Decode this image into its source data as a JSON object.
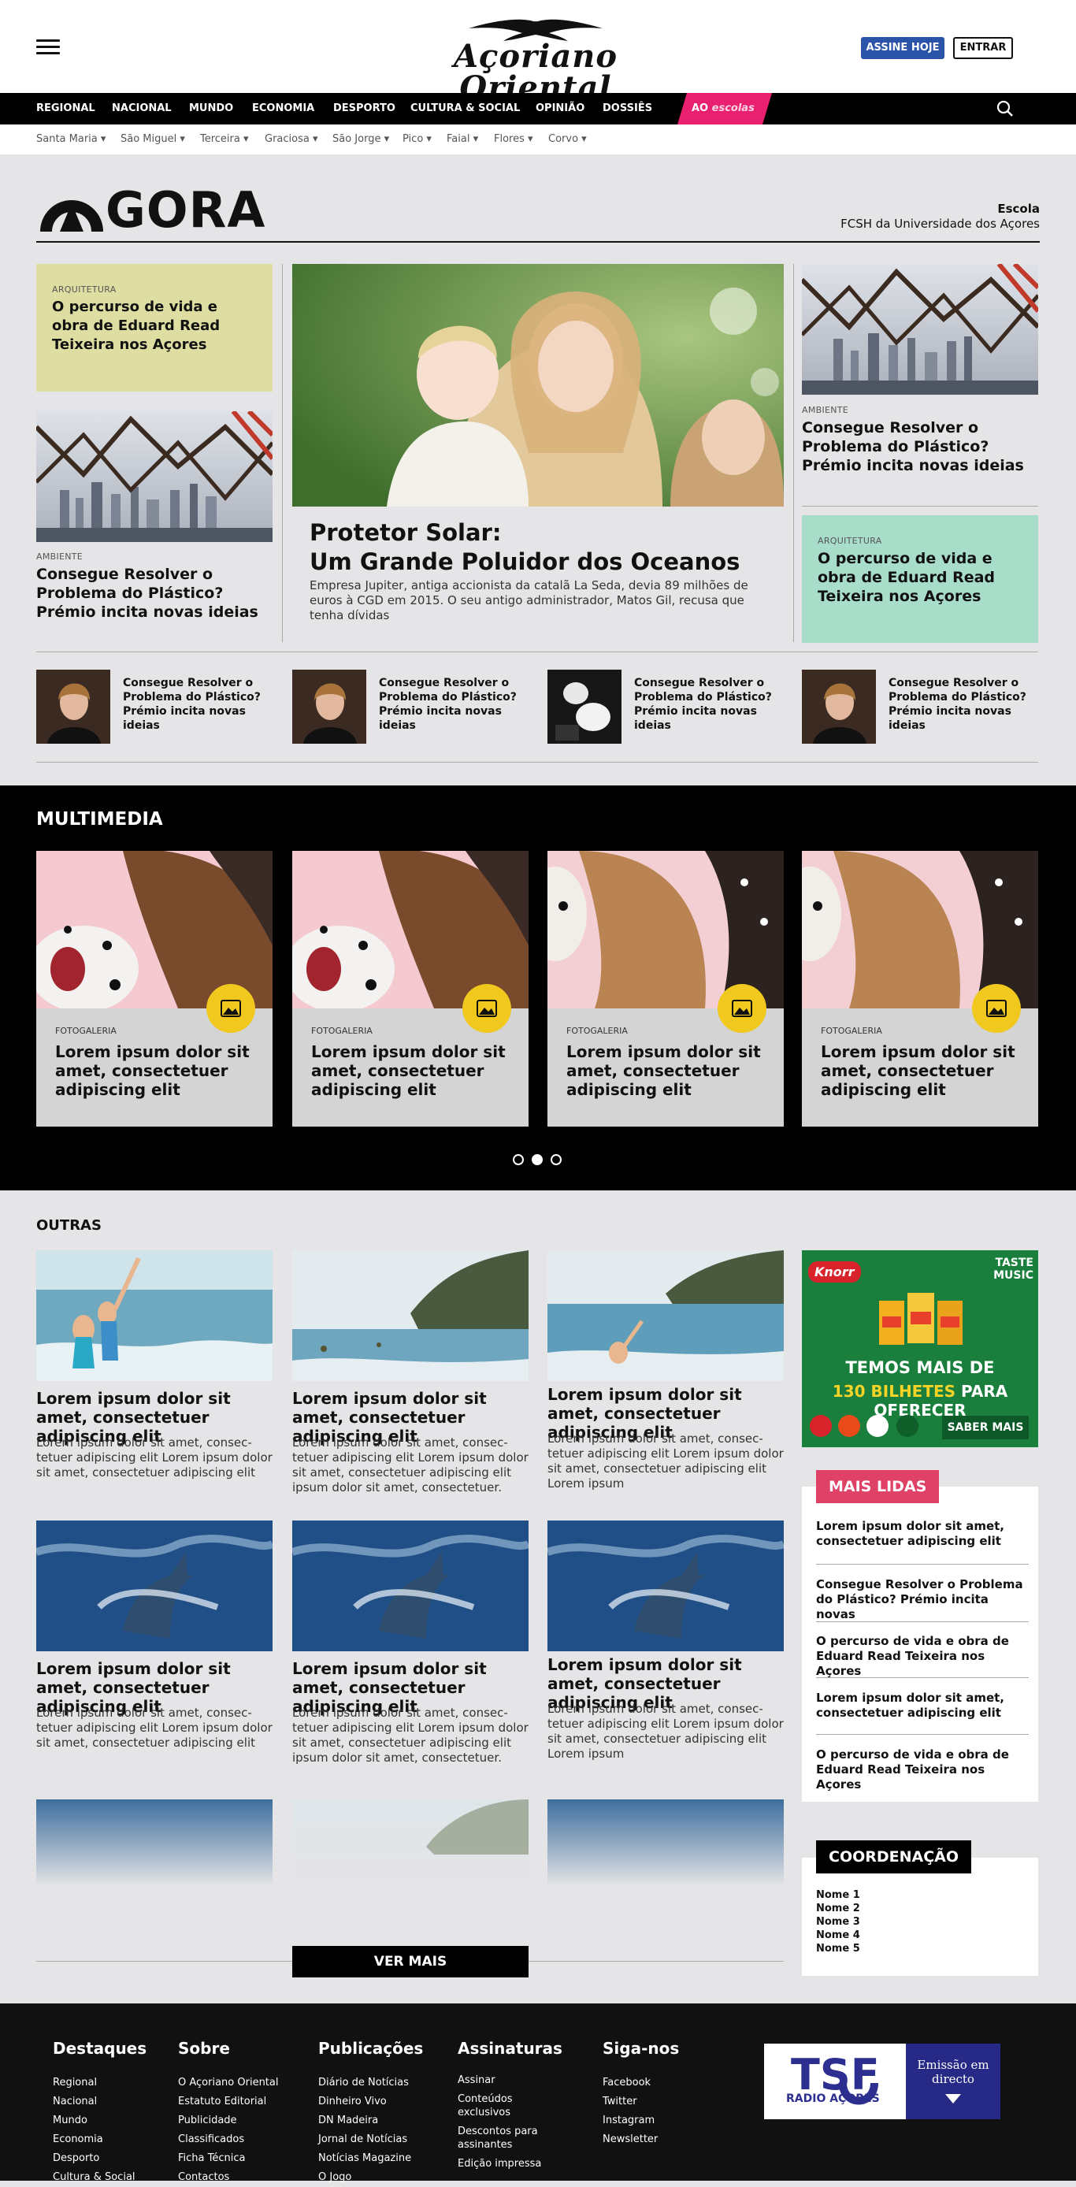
{
  "header": {
    "logo_text": "Açoriano Oriental",
    "subscribe": "ASSINE HOJE",
    "login": "ENTRAR"
  },
  "nav": {
    "items": [
      "REGIONAL",
      "NACIONAL",
      "MUNDO",
      "ECONOMIA",
      "DESPORTO",
      "CULTURA & SOCIAL",
      "OPINIÃO",
      "DOSSIÊS"
    ],
    "escolas_prefix": "AO",
    "escolas_word": "escolas"
  },
  "subnav": [
    "Santa Maria",
    "São Miguel",
    "Terceira",
    "Graciosa",
    "São Jorge",
    "Pico",
    "Faial",
    "Flores",
    "Corvo"
  ],
  "agora": {
    "logo_text": "GORA",
    "school_label": "Escola",
    "school_name": "FCSH da Universidade dos Açores",
    "left_top": {
      "kicker": "ARQUITETURA",
      "title": "O percurso de vida e obra de Eduard Read Teixeira nos Açores"
    },
    "left_bottom": {
      "kicker": "AMBIENTE",
      "title": "Consegue Resolver o Problema do Plástico? Prémio incita novas ideias"
    },
    "main": {
      "title_line1": "Protetor Solar:",
      "title_line2": "Um Grande Poluidor dos Oceanos",
      "desc": "Empresa Jupiter, antiga accionista da catalã La Seda, devia 89 milhões de euros à CGD em 2015. O seu antigo administrador, Matos Gil, recusa que tenha dívidas"
    },
    "right_top": {
      "kicker": "AMBIENTE",
      "title": "Consegue Resolver o Problema do Plástico? Prémio incita novas ideias"
    },
    "right_bottom": {
      "kicker": "ARQUITETURA",
      "title": "O percurso de vida e obra de Eduard Read Teixeira nos Açores"
    },
    "small": [
      "Consegue Resolver o Problema do Plástico? Prémio incita novas ideias",
      "Consegue Resolver o Problema do Plástico? Prémio incita novas ideias",
      "Consegue Resolver o Problema do Plástico? Prémio incita novas ideias",
      "Consegue Resolver o Problema do Plástico? Prémio incita novas ideias"
    ]
  },
  "multimedia": {
    "heading": "MULTIMEDIA",
    "cards": [
      {
        "kicker": "FOTOGALERIA",
        "title": "Lorem ipsum dolor sit amet, consectetuer adipiscing elit"
      },
      {
        "kicker": "FOTOGALERIA",
        "title": "Lorem ipsum dolor sit amet, consectetuer adipiscing elit"
      },
      {
        "kicker": "FOTOGALERIA",
        "title": "Lorem ipsum dolor sit amet, consectetuer adipiscing elit"
      },
      {
        "kicker": "FOTOGALERIA",
        "title": "Lorem ipsum dolor sit amet, consectetuer adipiscing elit"
      }
    ]
  },
  "outras": {
    "heading": "OUTRAS",
    "articles": [
      {
        "title": "Lorem ipsum dolor sit amet, consectetuer adipiscing elit",
        "desc": "Lorem ipsum dolor sit amet, consec-tetuer adipiscing elit Lorem ipsum dolor sit amet, consectetuer adipiscing elit"
      },
      {
        "title": "Lorem ipsum dolor sit amet, consectetuer adipiscing elit",
        "desc": "Lorem ipsum dolor sit amet, consec-tetuer adipiscing elit Lorem ipsum dolor sit amet, consectetuer adipiscing elit ipsum dolor sit amet, consectetuer."
      },
      {
        "title": "Lorem ipsum dolor sit amet, consectetuer adipiscing elit",
        "desc": "Lorem ipsum dolor sit amet, consec-tetuer adipiscing elit Lorem ipsum dolor sit amet, consectetuer adipiscing elit Lorem ipsum"
      },
      {
        "title": "Lorem ipsum dolor sit amet, consectetuer adipiscing elit",
        "desc": "Lorem ipsum dolor sit amet, consec-tetuer adipiscing elit Lorem ipsum dolor sit amet, consectetuer adipiscing elit"
      },
      {
        "title": "Lorem ipsum dolor sit amet, consectetuer adipiscing elit",
        "desc": "Lorem ipsum dolor sit amet, consec-tetuer adipiscing elit Lorem ipsum dolor sit amet, consectetuer adipiscing elit ipsum dolor sit amet, consectetuer."
      },
      {
        "title": "Lorem ipsum dolor sit amet, consectetuer adipiscing elit",
        "desc": "Lorem ipsum dolor sit amet, consec-tetuer adipiscing elit Lorem ipsum dolor sit amet, consectetuer adipiscing elit Lorem ipsum"
      }
    ],
    "see_more": "VER MAIS"
  },
  "ad": {
    "brand": "Knorr",
    "corner": "TASTE MUSIC",
    "line1": "TEMOS MAIS DE",
    "line2_highlight": "130 BILHETES",
    "line2_rest": "PARA OFERECER",
    "cta": "SABER MAIS"
  },
  "mais_lidas": {
    "heading": "MAIS LIDAS",
    "items": [
      "Lorem ipsum dolor sit amet, consectetuer adipiscing elit",
      "Consegue Resolver o Problema do Plástico? Prémio incita novas",
      "O percurso de vida e obra de Eduard Read Teixeira nos Açores",
      "Lorem ipsum dolor sit amet, consectetuer adipiscing elit",
      "O percurso de vida e obra de Eduard Read Teixeira nos Açores"
    ]
  },
  "coordenacao": {
    "heading": "COORDENAÇÃO",
    "names": [
      "Nome 1",
      "Nome 2",
      "Nome 3",
      "Nome 4",
      "Nome 5"
    ]
  },
  "footer": {
    "columns": [
      {
        "heading": "Destaques",
        "links": [
          "Regional",
          "Nacional",
          "Mundo",
          "Economia",
          "Desporto",
          "Cultura & Social"
        ]
      },
      {
        "heading": "Sobre",
        "links": [
          "O Açoriano Oriental",
          "Estatuto Editorial",
          "Publicidade",
          "Classificados",
          "Ficha Técnica",
          "Contactos"
        ]
      },
      {
        "heading": "Publicações",
        "links": [
          "Diário de Notícias",
          "Dinheiro Vivo",
          "DN Madeira",
          "Jornal de Notícias",
          "Notícias Magazine",
          "O Jogo"
        ]
      },
      {
        "heading": "Assinaturas",
        "links": [
          "Assinar",
          "Conteúdos exclusivos",
          "Descontos para assinantes",
          "Edição impressa"
        ]
      },
      {
        "heading": "Siga-nos",
        "links": [
          "Facebook",
          "Twitter",
          "Instagram",
          "Newsletter"
        ]
      }
    ],
    "radio_name": "RADIO AÇORES",
    "radio_live": "Emissão em directo"
  }
}
